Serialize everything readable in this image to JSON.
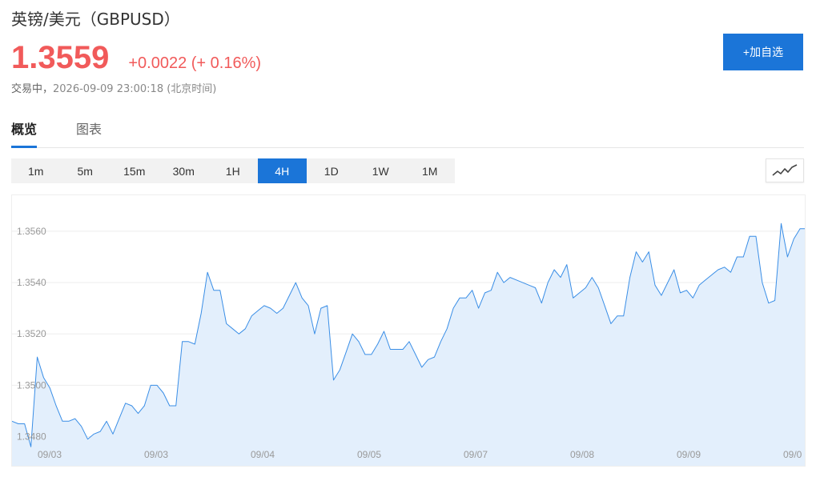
{
  "header": {
    "title": "英镑/美元（GBPUSD）",
    "price": "1.3559",
    "change": "+0.0022 (+ 0.16%)",
    "status_label": "交易中，",
    "timestamp": "2026-09-09 23:00:18 (北京时间)",
    "add_watchlist_label": "+加自选"
  },
  "tabs": [
    {
      "label": "概览",
      "active": true
    },
    {
      "label": "图表",
      "active": false
    }
  ],
  "intervals": [
    {
      "label": "1m",
      "active": false
    },
    {
      "label": "5m",
      "active": false
    },
    {
      "label": "15m",
      "active": false
    },
    {
      "label": "30m",
      "active": false
    },
    {
      "label": "1H",
      "active": false
    },
    {
      "label": "4H",
      "active": true
    },
    {
      "label": "1D",
      "active": false
    },
    {
      "label": "1W",
      "active": false
    },
    {
      "label": "1M",
      "active": false
    }
  ],
  "chart_type_icon": "line-chart-icon",
  "colors": {
    "up": "#f15a5a",
    "accent": "#1b75d8",
    "line": "#3a8ee6",
    "area": "#e3effc",
    "grid": "#eeeeee"
  },
  "chart_data": {
    "type": "area",
    "y_ticks": [
      "1.3480",
      "1.3500",
      "1.3520",
      "1.3540",
      "1.3560"
    ],
    "x_tick_labels": [
      "09/03",
      "09/03",
      "09/04",
      "09/05",
      "09/07",
      "09/08",
      "09/09",
      "09/0"
    ],
    "ylim": [
      1.3468,
      1.3574
    ],
    "grid": true,
    "values": [
      1.3486,
      1.3485,
      1.3485,
      1.3476,
      1.3511,
      1.3503,
      1.3499,
      1.3492,
      1.3486,
      1.3486,
      1.3487,
      1.3484,
      1.3479,
      1.3481,
      1.3482,
      1.3486,
      1.3481,
      1.3487,
      1.3493,
      1.3492,
      1.3489,
      1.3492,
      1.35,
      1.35,
      1.3497,
      1.3492,
      1.3492,
      1.3517,
      1.3517,
      1.3516,
      1.3528,
      1.3544,
      1.3537,
      1.3537,
      1.3524,
      1.3522,
      1.352,
      1.3522,
      1.3527,
      1.3529,
      1.3531,
      1.353,
      1.3528,
      1.353,
      1.3535,
      1.354,
      1.3534,
      1.3531,
      1.352,
      1.353,
      1.3531,
      1.3502,
      1.3506,
      1.3513,
      1.352,
      1.3517,
      1.3512,
      1.3512,
      1.3516,
      1.3521,
      1.3514,
      1.3514,
      1.3514,
      1.3517,
      1.3512,
      1.3507,
      1.351,
      1.3511,
      1.3517,
      1.3522,
      1.353,
      1.3534,
      1.3534,
      1.3537,
      1.353,
      1.3536,
      1.3537,
      1.3544,
      1.354,
      1.3542,
      1.3541,
      1.354,
      1.3539,
      1.3538,
      1.3532,
      1.354,
      1.3545,
      1.3542,
      1.3547,
      1.3534,
      1.3536,
      1.3538,
      1.3542,
      1.3538,
      1.3531,
      1.3524,
      1.3527,
      1.3527,
      1.3542,
      1.3552,
      1.3548,
      1.3552,
      1.3539,
      1.3535,
      1.354,
      1.3545,
      1.3536,
      1.3537,
      1.3534,
      1.3539,
      1.3541,
      1.3543,
      1.3545,
      1.3546,
      1.3544,
      1.355,
      1.355,
      1.3558,
      1.3558,
      1.354,
      1.3532,
      1.3533,
      1.3563,
      1.355,
      1.3557,
      1.3561,
      1.3561
    ]
  }
}
